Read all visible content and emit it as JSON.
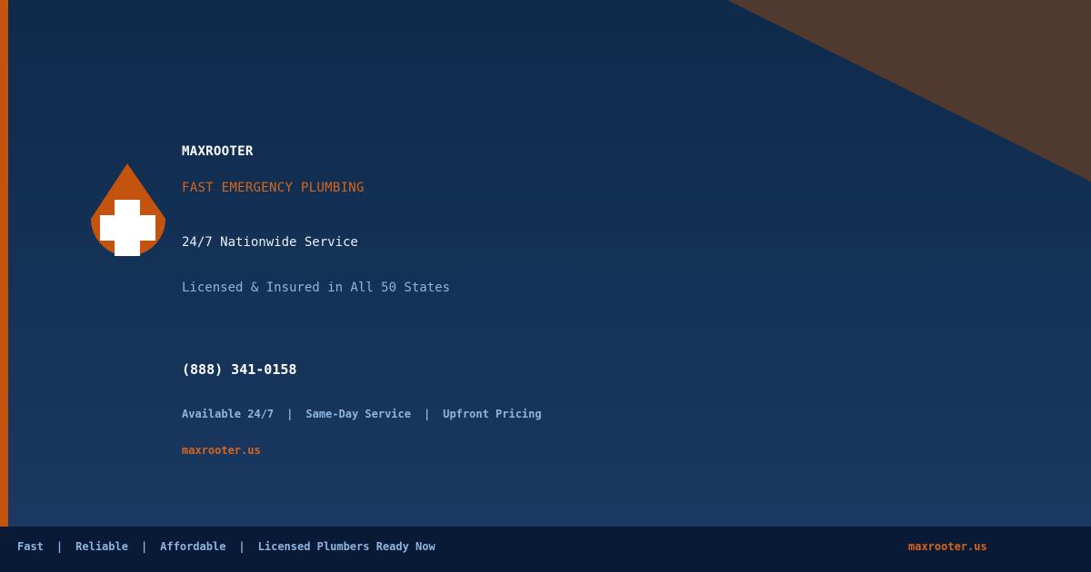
{
  "brand": {
    "name": "MAXROOTER",
    "tagline": "FAST EMERGENCY PLUMBING",
    "logo_icon": "water-drop-cross-icon"
  },
  "info": {
    "service": "24/7 Nationwide Service",
    "license": "Licensed & Insured in All 50 States"
  },
  "contact": {
    "phone": "(888) 341-0158",
    "website": "maxrooter.us"
  },
  "features": [
    "Available 24/7",
    "Same-Day Service",
    "Upfront Pricing"
  ],
  "footer": {
    "items": [
      "Fast",
      "Reliable",
      "Affordable",
      "Licensed Plumbers Ready Now"
    ],
    "website": "maxrooter.us"
  },
  "separator": "|",
  "colors": {
    "background_top": "#0e2a4b",
    "background_bottom": "#1b3a63",
    "accent": "#c4530d",
    "accent_text": "#d9651a",
    "corner": "#503a30",
    "footer": "#081a36",
    "muted_text": "#8fb4df"
  }
}
